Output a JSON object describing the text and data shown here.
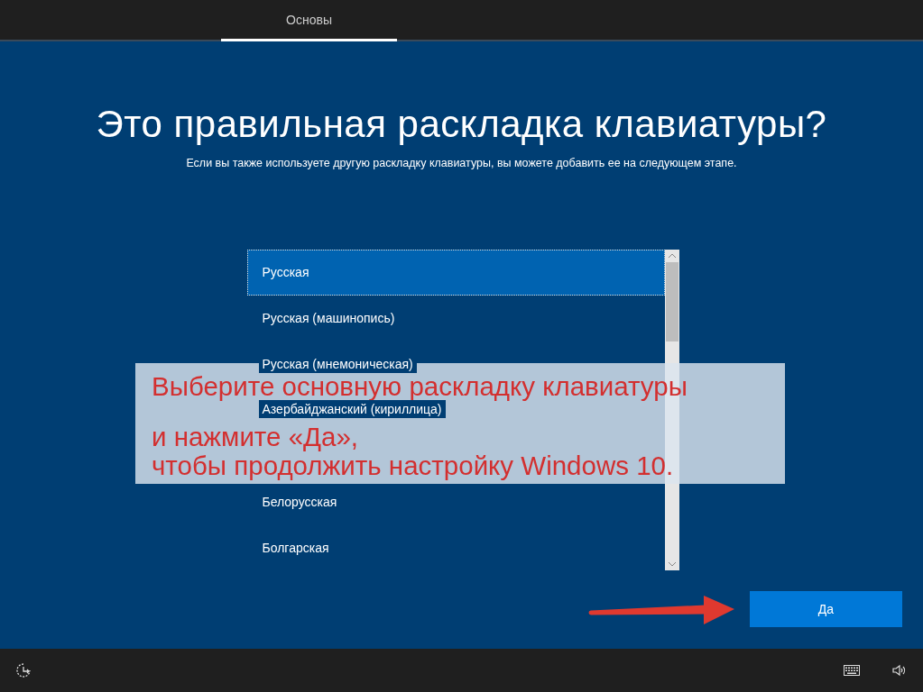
{
  "header": {
    "tabs": [
      {
        "label": "Основы",
        "selected": true
      }
    ]
  },
  "title": "Это правильная раскладка клавиатуры?",
  "subtitle": "Если вы также используете другую раскладку клавиатуры, вы можете добавить ее на следующем этапе.",
  "layouts": [
    {
      "label": "Русская",
      "selected": true
    },
    {
      "label": "Русская (машинопись)",
      "selected": false
    },
    {
      "label": "Русская (мнемоническая)",
      "selected": false
    },
    {
      "label": "Азербайджанский (кириллица)",
      "selected": false
    },
    {
      "label": "Белорусская",
      "selected": false
    },
    {
      "label": "Болгарская",
      "selected": false
    }
  ],
  "callout": {
    "lines": [
      "Выберите основную раскладку клавиатуры",
      "и нажмите «Да»,",
      "чтобы продолжить настройку Windows 10."
    ]
  },
  "yes_button": "Да"
}
